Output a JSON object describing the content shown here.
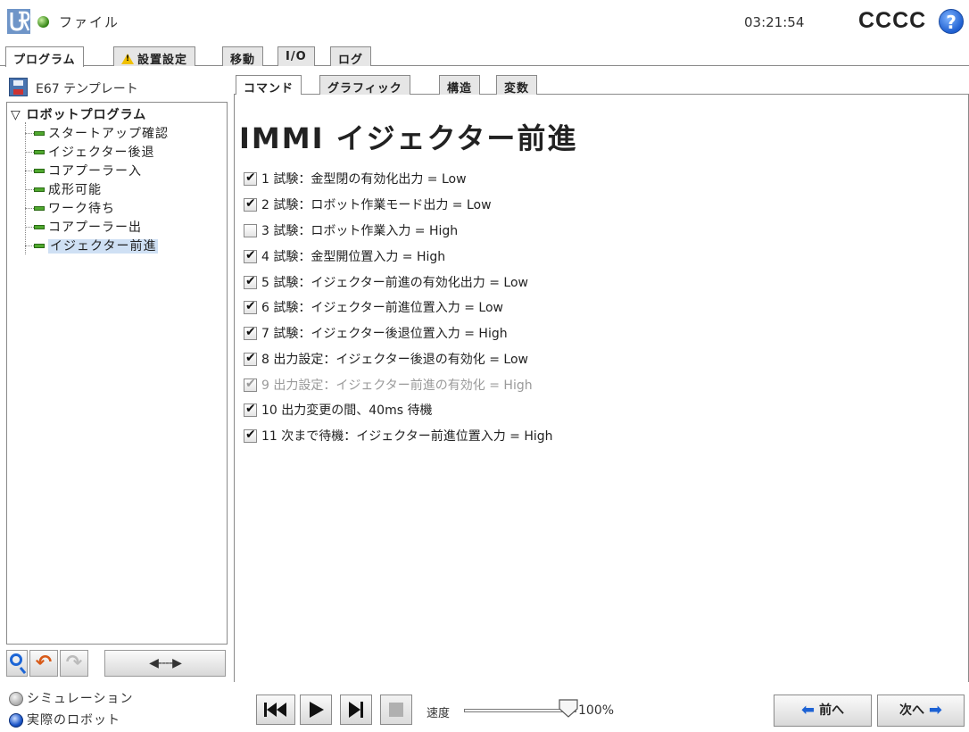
{
  "header": {
    "file_menu": "ファイル",
    "clock": "03:21:54",
    "robot_name": "CCCC",
    "help_glyph": "?"
  },
  "main_tabs": [
    {
      "label": "プログラム",
      "active": true
    },
    {
      "label": "設置設定",
      "active": false
    },
    {
      "label": "移動",
      "active": false
    },
    {
      "label": "I/O",
      "active": false
    },
    {
      "label": "ログ",
      "active": false
    }
  ],
  "program": {
    "name": "E67 テンプレート",
    "tree_root": "ロボットプログラム",
    "tree_items": [
      {
        "label": "スタートアップ確認",
        "selected": false
      },
      {
        "label": "イジェクター後退",
        "selected": false
      },
      {
        "label": "コアプーラー入",
        "selected": false
      },
      {
        "label": "成形可能",
        "selected": false
      },
      {
        "label": "ワーク待ち",
        "selected": false
      },
      {
        "label": "コアプーラー出",
        "selected": false
      },
      {
        "label": "イジェクター前進",
        "selected": true
      }
    ]
  },
  "sub_tabs": [
    {
      "label": "コマンド",
      "active": true
    },
    {
      "label": "グラフィック",
      "active": false
    },
    {
      "label": "構造",
      "active": false
    },
    {
      "label": "変数",
      "active": false
    }
  ],
  "content": {
    "title": "IMMI イジェクター前進",
    "conditions": [
      {
        "text": "1 試験：金型閉の有効化出力 = Low",
        "checked": true,
        "disabled": false
      },
      {
        "text": "2 試験：ロボット作業モード出力 = Low",
        "checked": true,
        "disabled": false
      },
      {
        "text": "3 試験：ロボット作業入力 = High",
        "checked": false,
        "disabled": false
      },
      {
        "text": "4 試験：金型開位置入力 = High",
        "checked": true,
        "disabled": false
      },
      {
        "text": "5 試験：イジェクター前進の有効化出力 = Low",
        "checked": true,
        "disabled": false
      },
      {
        "text": "6 試験：イジェクター前進位置入力 = Low",
        "checked": true,
        "disabled": false
      },
      {
        "text": "7 試験：イジェクター後退位置入力 = High",
        "checked": true,
        "disabled": false
      },
      {
        "text": "8 出力設定：イジェクター後退の有効化 = Low",
        "checked": true,
        "disabled": false
      },
      {
        "text": "9 出力設定：イジェクター前進の有効化 = High",
        "checked": true,
        "disabled": true
      },
      {
        "text": "10 出力変更の間、40ms 待機",
        "checked": true,
        "disabled": false
      },
      {
        "text": "11 次まで待機：イジェクター前進位置入力 = High",
        "checked": true,
        "disabled": false
      }
    ]
  },
  "footer": {
    "mode_simulation": "シミュレーション",
    "mode_real": "実際のロボット",
    "speed_label": "速度",
    "speed_value": "100%",
    "speed_fraction": 1.0,
    "prev_label": "前へ",
    "next_label": "次へ"
  },
  "colors": {
    "accent_blue": "#1d62d4",
    "node_green": "#4fa82e",
    "warning_yellow": "#f0c000",
    "undo_orange": "#d85a18"
  }
}
